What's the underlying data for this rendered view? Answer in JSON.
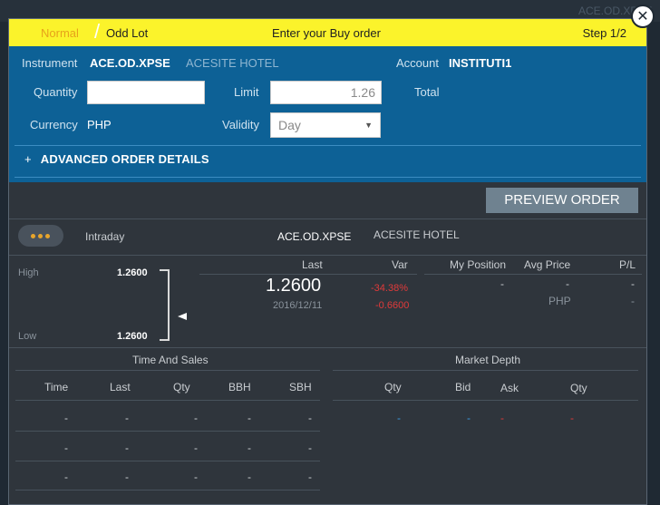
{
  "background": {
    "ghost_ticker": "ACE.OD.XPSE"
  },
  "close_label": "✕",
  "topbar": {
    "mode_normal": "Normal",
    "slash": "/",
    "mode_odd_lot": "Odd Lot",
    "heading": "Enter your Buy order",
    "step": "Step 1/2"
  },
  "order": {
    "instrument_label": "Instrument",
    "instrument_code": "ACE.OD.XPSE",
    "instrument_name": "ACESITE HOTEL",
    "account_label": "Account",
    "account_value": "INSTITUTI1",
    "quantity_label": "Quantity",
    "quantity_value": "",
    "limit_label": "Limit",
    "limit_value": "1.26",
    "total_label": "Total",
    "currency_label": "Currency",
    "currency_value": "PHP",
    "validity_label": "Validity",
    "validity_value": "Day",
    "advanced_plus": "+",
    "advanced_label": "ADVANCED ORDER DETAILS"
  },
  "preview_button": "PREVIEW ORDER",
  "quote": {
    "period": "Intraday",
    "ticker": "ACE.OD.XPSE",
    "name": "ACESITE HOTEL",
    "high_label": "High",
    "high_value": "1.2600",
    "low_label": "Low",
    "low_value": "1.2600",
    "last_label": "Last",
    "last_value": "1.2600",
    "last_date": "2016/12/11",
    "var_label": "Var",
    "var_pct": "-34.38%",
    "var_abs": "-0.6600",
    "position_label": "My Position",
    "avg_price_label": "Avg Price",
    "pl_label": "P/L",
    "position_value": "-",
    "avg_price_value": "-",
    "avg_price_currency": "PHP",
    "pl_value": "-",
    "pl_value2": "-"
  },
  "time_and_sales": {
    "title": "Time And Sales",
    "columns": [
      "Time",
      "Last",
      "Qty",
      "BBH",
      "SBH"
    ],
    "rows": [
      [
        "-",
        "-",
        "-",
        "-",
        "-"
      ],
      [
        "-",
        "-",
        "-",
        "-",
        "-"
      ],
      [
        "-",
        "-",
        "-",
        "-",
        "-"
      ]
    ]
  },
  "market_depth": {
    "title": "Market Depth",
    "columns": [
      "Qty",
      "Bid",
      "Ask",
      "Qty"
    ],
    "row": [
      "-",
      "-",
      "-",
      "-"
    ]
  },
  "colors": {
    "topbar": "#fbf32b",
    "order_panel": "#0d6196",
    "dialog": "#2f353c",
    "negative": "#e03a3a",
    "bid": "#3c9be0",
    "accent_dots": "#e8a52b"
  }
}
